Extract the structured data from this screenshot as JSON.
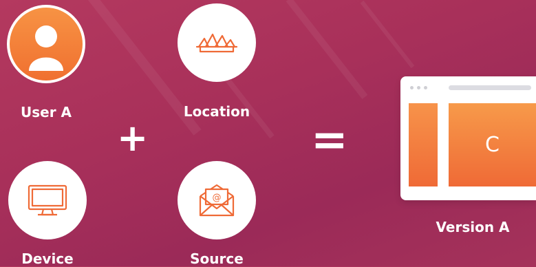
{
  "inputs": {
    "user": {
      "label": "User A",
      "icon": "user-icon"
    },
    "location": {
      "label": "Location",
      "icon": "opera-house-icon"
    },
    "device": {
      "label": "Device",
      "icon": "monitor-icon"
    },
    "source": {
      "label": "Source",
      "icon": "email-icon"
    }
  },
  "operators": {
    "plus": "+",
    "equals": "="
  },
  "result": {
    "content_letter": "C",
    "label": "Version A",
    "icon": "browser-window-icon"
  },
  "colors": {
    "background": "#a8305a",
    "accent": "#f07a3a",
    "circle": "#ffffff"
  }
}
